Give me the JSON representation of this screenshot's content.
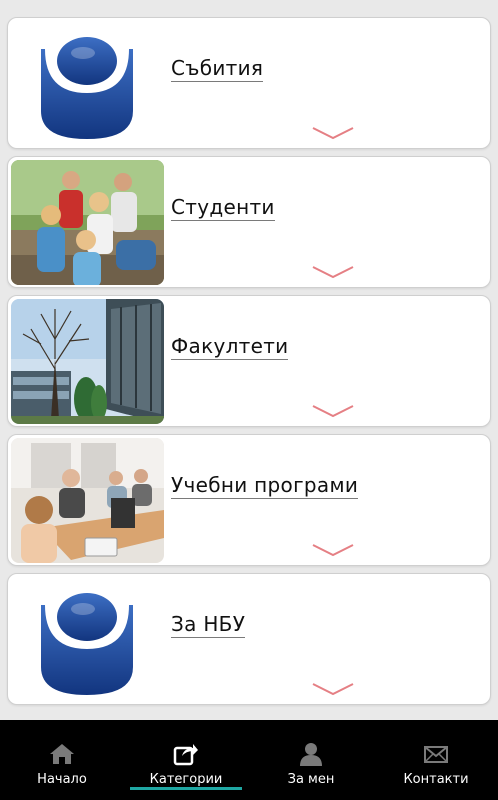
{
  "categories": [
    {
      "title": "Събития",
      "thumb": "nbu-logo"
    },
    {
      "title": "Студенти",
      "thumb": "students-photo"
    },
    {
      "title": "Факултети",
      "thumb": "campus-building-photo"
    },
    {
      "title": "Учебни програми",
      "thumb": "classroom-photo"
    },
    {
      "title": "За НБУ",
      "thumb": "nbu-logo"
    }
  ],
  "tabbar": {
    "items": [
      {
        "label": "Начало",
        "icon": "home-icon"
      },
      {
        "label": "Категории",
        "icon": "share-icon",
        "active": true
      },
      {
        "label": "За мен",
        "icon": "user-icon"
      },
      {
        "label": "Контакти",
        "icon": "envelope-icon"
      }
    ]
  },
  "colors": {
    "chevron": "#e57f84",
    "active_tab_indicator": "#1fa7a3",
    "tabbar_background": "#000000",
    "logo_blue": "#1b4a9c"
  }
}
